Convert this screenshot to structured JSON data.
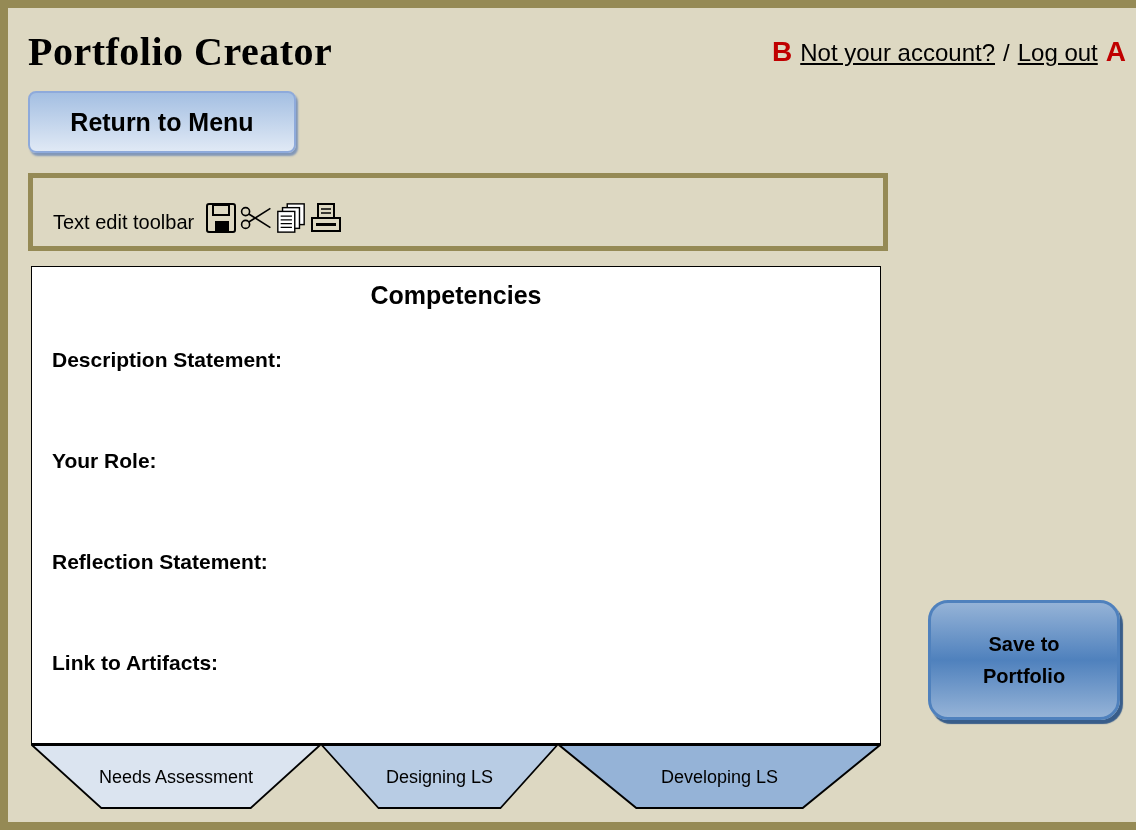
{
  "header": {
    "title": "Portfolio Creator",
    "account_links": [
      {
        "kind": "marker",
        "text": "B"
      },
      {
        "kind": "link",
        "text": "Not your account?"
      },
      {
        "kind": "separator",
        "text": "/"
      },
      {
        "kind": "link",
        "text": "Log out"
      },
      {
        "kind": "marker",
        "text": "A"
      }
    ]
  },
  "return_button": "Return to Menu",
  "toolbar": {
    "label": "Text edit toolbar"
  },
  "card": {
    "title": "Competencies",
    "fields": [
      "Description Statement:",
      "Your Role:",
      "Reflection Statement:",
      "Link to Artifacts:"
    ]
  },
  "tabs": [
    {
      "label": "Needs Assessment",
      "color": "#dbe4f0"
    },
    {
      "label": "Designing LS",
      "color": "#b8cce4"
    },
    {
      "label": "Developing LS",
      "color": "#95b3d7"
    }
  ],
  "save_button": "Save to Portfolio"
}
